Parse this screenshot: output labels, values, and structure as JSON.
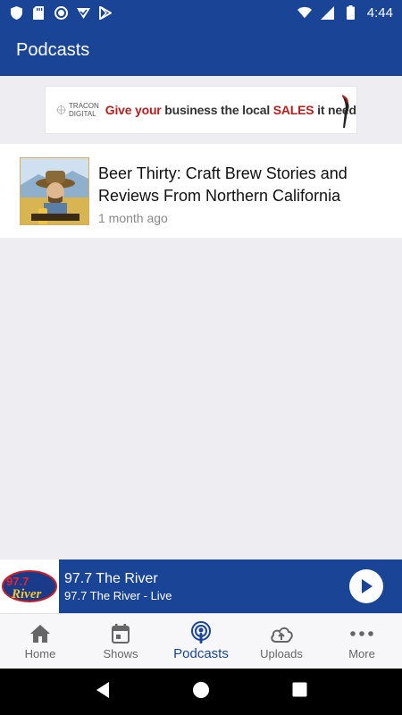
{
  "status_bar": {
    "time": "4:44",
    "left_icons": [
      "shield-icon",
      "sd-card-icon",
      "record-icon",
      "check-download-icon",
      "play-store-icon"
    ],
    "right_icons": [
      "wifi-icon",
      "signal-icon",
      "battery-icon"
    ]
  },
  "app_bar": {
    "title": "Podcasts"
  },
  "ad": {
    "logo_text": "TRACON DIGITAL",
    "text_part1": "Give your",
    "text_part2": "business the local",
    "text_part3": "SALES",
    "text_part4": "it needs"
  },
  "podcasts": [
    {
      "title": "Beer Thirty: Craft Brew Stories and Reviews From Northern California",
      "time": "1 month ago"
    }
  ],
  "player": {
    "station_logo_text": "97.7 The River",
    "title": "97.7 The River",
    "subtitle": "97.7 The River - Live"
  },
  "bottom_nav": [
    {
      "label": "Home",
      "icon": "home-icon"
    },
    {
      "label": "Shows",
      "icon": "calendar-icon"
    },
    {
      "label": "Podcasts",
      "icon": "podcast-icon",
      "active": true
    },
    {
      "label": "Uploads",
      "icon": "cloud-upload-icon"
    },
    {
      "label": "More",
      "icon": "more-dots-icon"
    }
  ],
  "colors": {
    "primary": "#1a4597",
    "background": "#eeeef2",
    "ad_red": "#b51f1f"
  }
}
